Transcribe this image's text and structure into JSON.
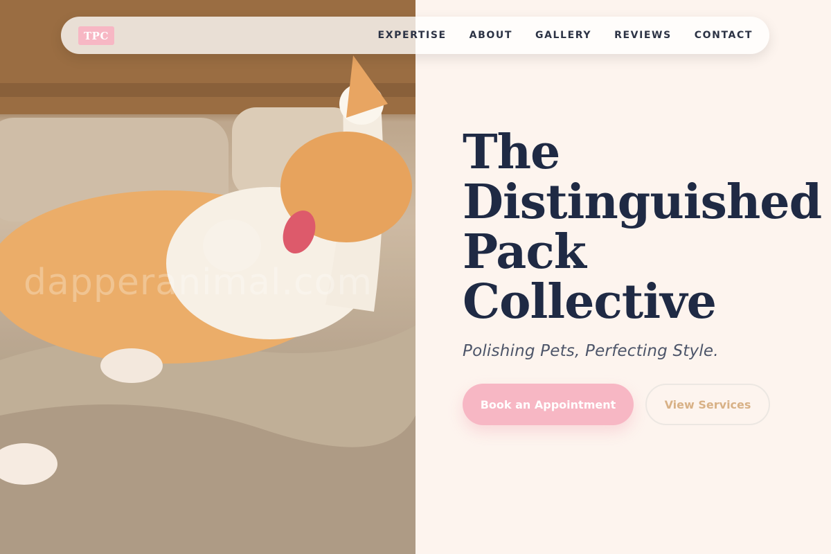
{
  "brand": {
    "logo_text": "TPC"
  },
  "nav": {
    "items": [
      {
        "label": "EXPERTISE"
      },
      {
        "label": "ABOUT"
      },
      {
        "label": "GALLERY"
      },
      {
        "label": "REVIEWS"
      },
      {
        "label": "CONTACT"
      }
    ]
  },
  "hero": {
    "title_lines": [
      "The",
      "Distinguished",
      "Pack",
      "Collective"
    ],
    "tagline": "Polishing Pets, Perfecting Style.",
    "primary_cta": "Book an Appointment",
    "secondary_cta": "View Services",
    "watermark": "dapperanimal.com"
  },
  "colors": {
    "accent_pink": "#f7b7c4",
    "title_navy": "#1f2a44",
    "secondary_gold": "#d8b186",
    "page_background": "#fdf4ee"
  }
}
